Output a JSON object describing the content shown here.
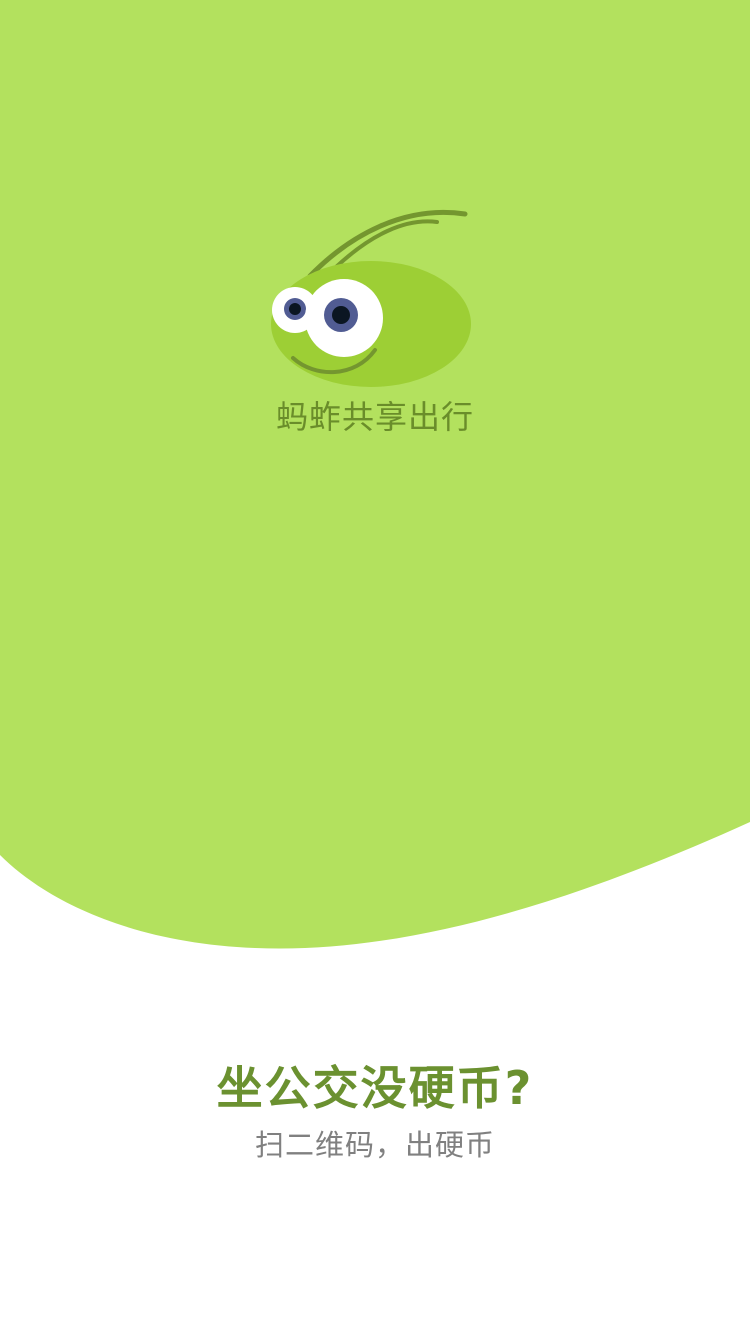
{
  "app": {
    "name": "蚂蚱共享出行",
    "logo_icon": "grasshopper-logo-icon"
  },
  "splash": {
    "headline": "坐公交没硬币?",
    "subline": "扫二维码，出硬币"
  },
  "colors": {
    "background_green": "#b3e15e",
    "logo_body": "#9dcf35",
    "logo_antenna": "#74962f",
    "text_green": "#6b9130",
    "text_gray": "#808080"
  }
}
